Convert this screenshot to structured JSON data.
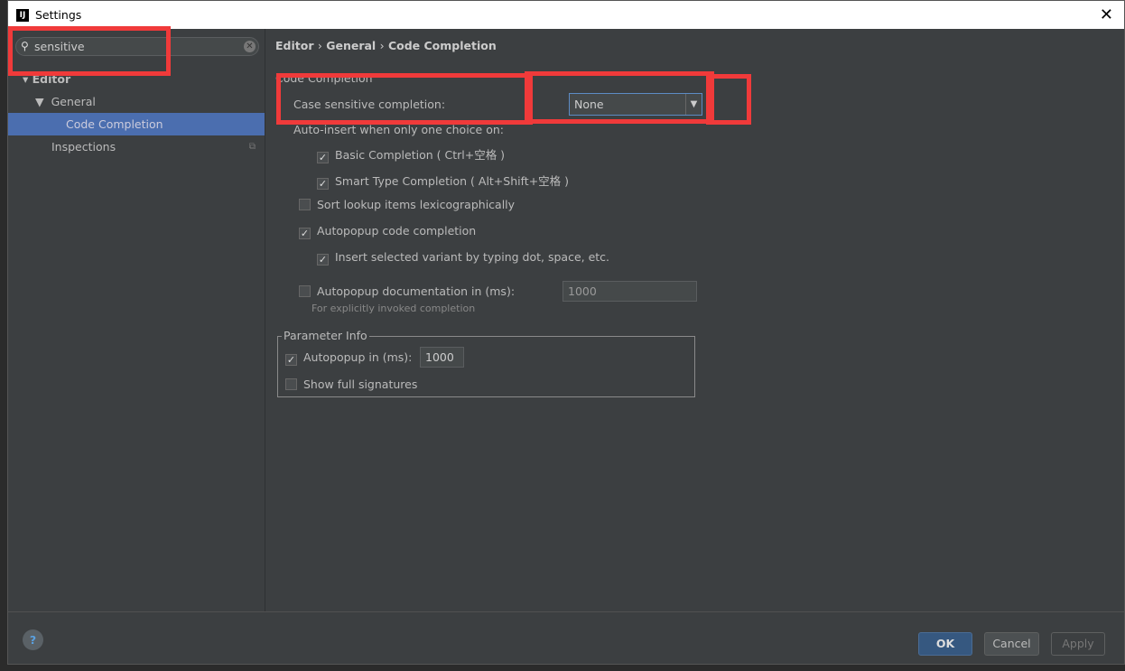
{
  "window": {
    "title": "Settings",
    "logo": "IJ",
    "close": "✕"
  },
  "search": {
    "value": "sensitive"
  },
  "tree": {
    "items": [
      {
        "label": "Editor"
      },
      {
        "label": "General"
      },
      {
        "label": "Code Completion"
      },
      {
        "label": "Inspections"
      }
    ]
  },
  "breadcrumb": {
    "editor": "Editor",
    "general": "General",
    "page": "Code Completion",
    "sep": "›"
  },
  "section_title": "Code Completion",
  "case_sensitive": {
    "label": "Case sensitive completion:",
    "value": "None"
  },
  "auto_insert": {
    "label": "Auto-insert when only one choice on:",
    "basic": "Basic Completion ( Ctrl+空格 )",
    "smart": "Smart Type Completion ( Alt+Shift+空格 )"
  },
  "sort": "Sort lookup items lexicographically",
  "autopopup": "Autopopup code completion",
  "insert_variant": "Insert selected variant by typing dot, space, etc.",
  "autopopup_doc": {
    "label": "Autopopup documentation in (ms):",
    "value": "1000",
    "hint": "For explicitly invoked completion"
  },
  "param_info": {
    "title": "Parameter Info",
    "autopopup": "Autopopup in (ms):",
    "value": "1000",
    "full_sig": "Show full signatures"
  },
  "footer": {
    "help": "?",
    "ok": "OK",
    "cancel": "Cancel",
    "apply": "Apply"
  },
  "colors": {
    "accent": "#4b6eaf",
    "highlight": "#f03a3a"
  }
}
